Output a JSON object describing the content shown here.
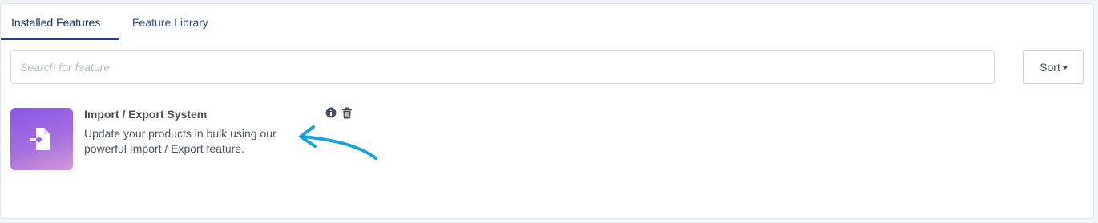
{
  "tabs": [
    {
      "label": "Installed Features",
      "active": true
    },
    {
      "label": "Feature Library",
      "active": false
    }
  ],
  "search": {
    "placeholder": "Search for feature",
    "value": ""
  },
  "sort": {
    "label": "Sort"
  },
  "features": [
    {
      "title": "Import / Export System",
      "description": "Update your products in bulk using our powerful Import / Export feature.",
      "icon": "file-import-icon",
      "actions": [
        "info-icon",
        "trash-icon"
      ]
    }
  ],
  "colors": {
    "accent": "#2a3b8f",
    "tab_text": "#3b4a8f",
    "icon_gradient_start": "#8a55e8",
    "icon_gradient_end": "#d49ad4",
    "annotation_arrow": "#1aa3d6"
  }
}
